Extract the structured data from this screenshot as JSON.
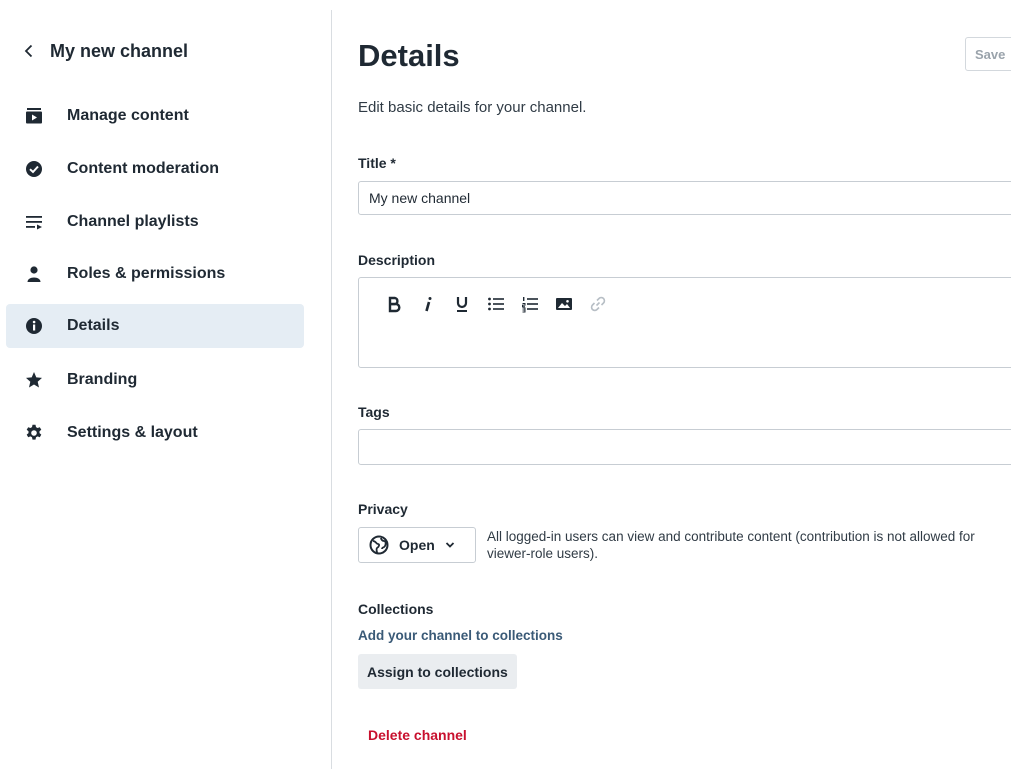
{
  "sidebar": {
    "back_title": "My new channel",
    "items": [
      {
        "label": "Manage content",
        "icon": "video-folder-icon"
      },
      {
        "label": "Content moderation",
        "icon": "check-circle-icon"
      },
      {
        "label": "Channel playlists",
        "icon": "playlist-icon"
      },
      {
        "label": "Roles & permissions",
        "icon": "user-icon"
      },
      {
        "label": "Details",
        "icon": "info-icon",
        "active": true
      },
      {
        "label": "Branding",
        "icon": "star-icon"
      },
      {
        "label": "Settings & layout",
        "icon": "gear-icon"
      }
    ]
  },
  "main": {
    "title": "Details",
    "save_label": "Save",
    "subtitle": "Edit basic details for your channel.",
    "title_field": {
      "label": "Title *",
      "value": "My new channel"
    },
    "description": {
      "label": "Description",
      "toolbar": [
        "bold-icon",
        "italic-icon",
        "underline-icon",
        "bullet-list-icon",
        "numbered-list-icon",
        "image-icon",
        "link-icon"
      ]
    },
    "tags": {
      "label": "Tags",
      "value": ""
    },
    "privacy": {
      "label": "Privacy",
      "value": "Open",
      "description": "All logged-in users can view and contribute content (contribution is not allowed for viewer-role users)."
    },
    "collections": {
      "label": "Collections",
      "link": "Add your channel to collections",
      "button": "Assign to collections"
    },
    "delete_label": "Delete channel"
  },
  "colors": {
    "active_bg": "#e5edf4",
    "text": "#1f2933",
    "link": "#3a5a77",
    "danger": "#c8102e"
  }
}
